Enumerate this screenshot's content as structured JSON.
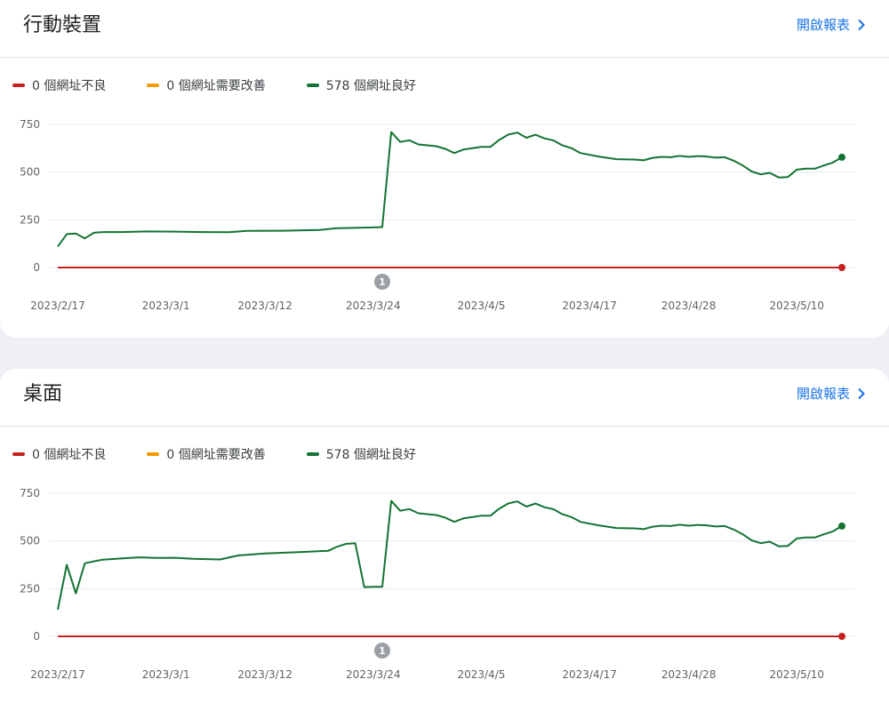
{
  "colors": {
    "poor": "#c5221f",
    "needs_improvement": "#f29900",
    "good": "#137333",
    "grid": "#e8eaed",
    "tick_text": "#5f6368",
    "link": "#1a73e8",
    "annotation_fill": "#9aa0a6"
  },
  "open_report_label": "開啟報表",
  "icons": {
    "open_report": "chevron-right-icon"
  },
  "sections": [
    {
      "title": "行動裝置",
      "legend": [
        {
          "label": "0 個網址不良",
          "color_key": "poor"
        },
        {
          "label": "0 個網址需要改善",
          "color_key": "needs_improvement"
        },
        {
          "label": "578 個網址良好",
          "color_key": "good"
        }
      ]
    },
    {
      "title": "桌面",
      "legend": [
        {
          "label": "0 個網址不良",
          "color_key": "poor"
        },
        {
          "label": "0 個網址需要改善",
          "color_key": "needs_improvement"
        },
        {
          "label": "578 個網址良好",
          "color_key": "good"
        }
      ]
    }
  ],
  "chart_data": [
    {
      "type": "line",
      "ylim": [
        0,
        750
      ],
      "yticks": [
        "0",
        "250",
        "500",
        "750"
      ],
      "grid": true,
      "legend_placement": "top-left",
      "xlim": [
        "2023/2/17",
        "2023/5/15"
      ],
      "x_tick_labels": [
        "2023/2/17",
        "2023/3/1",
        "2023/3/12",
        "2023/3/24",
        "2023/4/5",
        "2023/4/17",
        "2023/4/28",
        "2023/5/10"
      ],
      "annotation": {
        "label": "1",
        "x": "2023/3/25"
      },
      "series": [
        {
          "name": "0 個網址不良",
          "color_key": "poor",
          "end_marker": true,
          "points": [
            [
              "2023/2/17",
              0
            ],
            [
              "2023/5/15",
              0
            ]
          ]
        },
        {
          "name": "578 個網址良好",
          "color_key": "good",
          "end_marker": true,
          "points": [
            [
              "2023/2/17",
              110
            ],
            [
              "2023/2/18",
              175
            ],
            [
              "2023/2/19",
              178
            ],
            [
              "2023/2/20",
              153
            ],
            [
              "2023/2/21",
              182
            ],
            [
              "2023/2/22",
              186
            ],
            [
              "2023/2/24",
              186
            ],
            [
              "2023/2/27",
              189
            ],
            [
              "2023/3/2",
              188
            ],
            [
              "2023/3/5",
              186
            ],
            [
              "2023/3/8",
              185
            ],
            [
              "2023/3/10",
              192
            ],
            [
              "2023/3/14",
              193
            ],
            [
              "2023/3/18",
              197
            ],
            [
              "2023/3/20",
              206
            ],
            [
              "2023/3/24",
              210
            ],
            [
              "2023/3/25",
              212
            ],
            [
              "2023/3/26",
              710
            ],
            [
              "2023/3/27",
              658
            ],
            [
              "2023/3/28",
              667
            ],
            [
              "2023/3/29",
              645
            ],
            [
              "2023/3/31",
              636
            ],
            [
              "2023/4/1",
              622
            ],
            [
              "2023/4/2",
              600
            ],
            [
              "2023/4/3",
              618
            ],
            [
              "2023/4/5",
              632
            ],
            [
              "2023/4/6",
              632
            ],
            [
              "2023/4/7",
              670
            ],
            [
              "2023/4/8",
              697
            ],
            [
              "2023/4/9",
              707
            ],
            [
              "2023/4/10",
              680
            ],
            [
              "2023/4/11",
              696
            ],
            [
              "2023/4/12",
              677
            ],
            [
              "2023/4/13",
              666
            ],
            [
              "2023/4/14",
              640
            ],
            [
              "2023/4/15",
              625
            ],
            [
              "2023/4/16",
              600
            ],
            [
              "2023/4/18",
              582
            ],
            [
              "2023/4/20",
              568
            ],
            [
              "2023/4/22",
              566
            ],
            [
              "2023/4/23",
              562
            ],
            [
              "2023/4/24",
              575
            ],
            [
              "2023/4/25",
              580
            ],
            [
              "2023/4/26",
              578
            ],
            [
              "2023/4/27",
              585
            ],
            [
              "2023/4/28",
              580
            ],
            [
              "2023/4/29",
              584
            ],
            [
              "2023/4/30",
              582
            ],
            [
              "2023/5/1",
              576
            ],
            [
              "2023/5/2",
              578
            ],
            [
              "2023/5/3",
              560
            ],
            [
              "2023/5/4",
              535
            ],
            [
              "2023/5/5",
              503
            ],
            [
              "2023/5/6",
              488
            ],
            [
              "2023/5/7",
              496
            ],
            [
              "2023/5/8",
              472
            ],
            [
              "2023/5/9",
              474
            ],
            [
              "2023/5/10",
              513
            ],
            [
              "2023/5/11",
              518
            ],
            [
              "2023/5/12",
              518
            ],
            [
              "2023/5/13",
              535
            ],
            [
              "2023/5/14",
              550
            ],
            [
              "2023/5/15",
              578
            ]
          ]
        }
      ]
    },
    {
      "type": "line",
      "ylim": [
        0,
        750
      ],
      "yticks": [
        "0",
        "250",
        "500",
        "750"
      ],
      "grid": true,
      "legend_placement": "top-left",
      "xlim": [
        "2023/2/17",
        "2023/5/15"
      ],
      "x_tick_labels": [
        "2023/2/17",
        "2023/3/1",
        "2023/3/12",
        "2023/3/24",
        "2023/4/5",
        "2023/4/17",
        "2023/4/28",
        "2023/5/10"
      ],
      "annotation": {
        "label": "1",
        "x": "2023/3/25"
      },
      "series": [
        {
          "name": "0 個網址不良",
          "color_key": "poor",
          "end_marker": true,
          "points": [
            [
              "2023/2/17",
              0
            ],
            [
              "2023/5/15",
              0
            ]
          ]
        },
        {
          "name": "578 個網址良好",
          "color_key": "good",
          "end_marker": true,
          "points": [
            [
              "2023/2/17",
              140
            ],
            [
              "2023/2/18",
              375
            ],
            [
              "2023/2/19",
              225
            ],
            [
              "2023/2/20",
              383
            ],
            [
              "2023/2/21",
              393
            ],
            [
              "2023/2/22",
              402
            ],
            [
              "2023/2/24",
              408
            ],
            [
              "2023/2/26",
              414
            ],
            [
              "2023/2/28",
              411
            ],
            [
              "2023/3/2",
              412
            ],
            [
              "2023/3/4",
              406
            ],
            [
              "2023/3/7",
              403
            ],
            [
              "2023/3/9",
              424
            ],
            [
              "2023/3/12",
              434
            ],
            [
              "2023/3/16",
              442
            ],
            [
              "2023/3/19",
              448
            ],
            [
              "2023/3/20",
              470
            ],
            [
              "2023/3/21",
              485
            ],
            [
              "2023/3/22",
              488
            ],
            [
              "2023/3/23",
              258
            ],
            [
              "2023/3/24",
              260
            ],
            [
              "2023/3/25",
              260
            ],
            [
              "2023/3/26",
              710
            ],
            [
              "2023/3/27",
              658
            ],
            [
              "2023/3/28",
              667
            ],
            [
              "2023/3/29",
              645
            ],
            [
              "2023/3/31",
              636
            ],
            [
              "2023/4/1",
              622
            ],
            [
              "2023/4/2",
              600
            ],
            [
              "2023/4/3",
              618
            ],
            [
              "2023/4/5",
              632
            ],
            [
              "2023/4/6",
              632
            ],
            [
              "2023/4/7",
              670
            ],
            [
              "2023/4/8",
              697
            ],
            [
              "2023/4/9",
              707
            ],
            [
              "2023/4/10",
              680
            ],
            [
              "2023/4/11",
              696
            ],
            [
              "2023/4/12",
              677
            ],
            [
              "2023/4/13",
              666
            ],
            [
              "2023/4/14",
              640
            ],
            [
              "2023/4/15",
              625
            ],
            [
              "2023/4/16",
              600
            ],
            [
              "2023/4/18",
              582
            ],
            [
              "2023/4/20",
              568
            ],
            [
              "2023/4/22",
              566
            ],
            [
              "2023/4/23",
              562
            ],
            [
              "2023/4/24",
              575
            ],
            [
              "2023/4/25",
              580
            ],
            [
              "2023/4/26",
              578
            ],
            [
              "2023/4/27",
              585
            ],
            [
              "2023/4/28",
              580
            ],
            [
              "2023/4/29",
              584
            ],
            [
              "2023/4/30",
              582
            ],
            [
              "2023/5/1",
              576
            ],
            [
              "2023/5/2",
              578
            ],
            [
              "2023/5/3",
              560
            ],
            [
              "2023/5/4",
              535
            ],
            [
              "2023/5/5",
              503
            ],
            [
              "2023/5/6",
              488
            ],
            [
              "2023/5/7",
              496
            ],
            [
              "2023/5/8",
              472
            ],
            [
              "2023/5/9",
              474
            ],
            [
              "2023/5/10",
              513
            ],
            [
              "2023/5/11",
              518
            ],
            [
              "2023/5/12",
              518
            ],
            [
              "2023/5/13",
              535
            ],
            [
              "2023/5/14",
              550
            ],
            [
              "2023/5/15",
              578
            ]
          ]
        }
      ]
    }
  ]
}
